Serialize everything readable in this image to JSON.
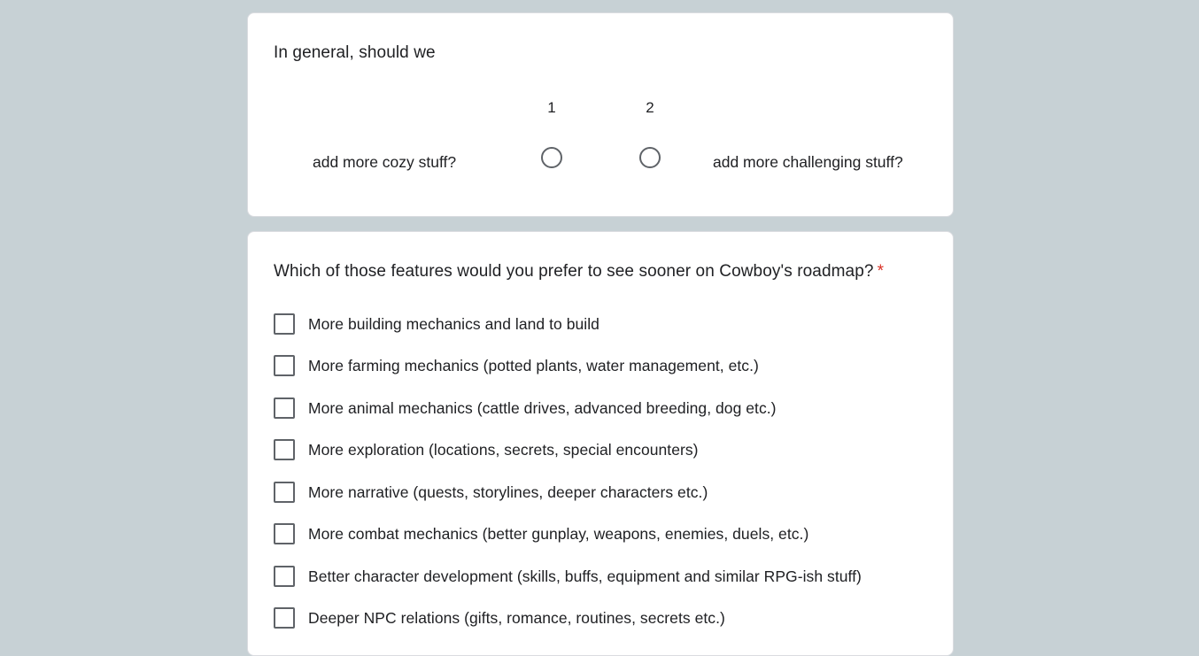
{
  "scale_question": {
    "title": "In general, should we",
    "scale": [
      "1",
      "2"
    ],
    "left_label": "add more cozy stuff?",
    "right_label": "add more challenging stuff?"
  },
  "features_question": {
    "title": "Which of those features would you prefer to see sooner on Cowboy's roadmap?",
    "required_marker": "*",
    "options": [
      "More building mechanics and land to build",
      "More farming mechanics (potted plants, water management, etc.)",
      "More animal mechanics (cattle drives, advanced breeding, dog etc.)",
      "More exploration (locations, secrets, special encounters)",
      "More narrative (quests, storylines, deeper characters etc.)",
      "More combat mechanics (better gunplay, weapons, enemies, duels, etc.)",
      "Better character development (skills, buffs, equipment and similar RPG-ish stuff)",
      "Deeper NPC relations (gifts, romance, routines, secrets etc.)"
    ]
  },
  "colors": {
    "page_background": "#c7d1d5",
    "card_background": "#ffffff",
    "text": "#202124",
    "required": "#d93025",
    "control_border": "#5f6368"
  }
}
